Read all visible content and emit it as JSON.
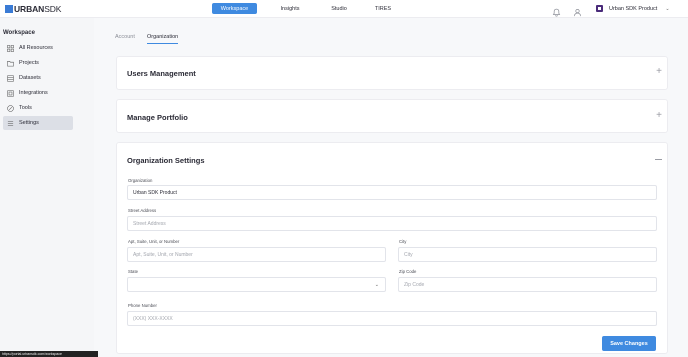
{
  "brand": {
    "name_bold": "URBAN",
    "name_light": "SDK"
  },
  "nav": {
    "tabs": [
      {
        "label": "Workspace",
        "active": true
      },
      {
        "label": "Insights",
        "active": false
      },
      {
        "label": "Studio",
        "active": false
      },
      {
        "label": "TIRES",
        "active": false
      }
    ]
  },
  "topbar": {
    "org_name": "Urban SDK Product",
    "icons": [
      "bell-icon",
      "user-icon",
      "chevron-down-icon"
    ]
  },
  "sidebar": {
    "title": "Workspace",
    "items": [
      {
        "label": "All Resources",
        "icon": "grid-icon"
      },
      {
        "label": "Projects",
        "icon": "folder-icon"
      },
      {
        "label": "Datasets",
        "icon": "database-icon"
      },
      {
        "label": "Integrations",
        "icon": "integrations-icon"
      },
      {
        "label": "Tools",
        "icon": "tools-icon"
      },
      {
        "label": "Settings",
        "icon": "settings-icon",
        "active": true
      }
    ]
  },
  "main": {
    "tabs": [
      {
        "label": "Account",
        "active": false
      },
      {
        "label": "Organization",
        "active": true
      }
    ],
    "sections": {
      "users": {
        "title": "Users Management"
      },
      "portfolio": {
        "title": "Manage Portfolio"
      },
      "org_settings": {
        "title": "Organization Settings"
      }
    },
    "form": {
      "organization": {
        "label": "Organization",
        "value": "Urban SDK Product"
      },
      "street": {
        "label": "Street Address",
        "placeholder": "Street Address"
      },
      "apt": {
        "label": "Apt, Suite, Unit, or Number",
        "placeholder": "Apt, Suite, Unit, or Number"
      },
      "city": {
        "label": "City",
        "placeholder": "City"
      },
      "state": {
        "label": "State",
        "value": ""
      },
      "zip": {
        "label": "Zip Code",
        "placeholder": "Zip Code"
      },
      "phone": {
        "label": "Phone Number",
        "placeholder": "(XXX) XXX-XXXX"
      }
    },
    "save_label": "Save Changes"
  },
  "status_bar": {
    "text": "https://portal.urbansdk.com/workspace"
  },
  "colors": {
    "accent": "#3f8ae0",
    "org_avatar": "#4a2b7a"
  }
}
